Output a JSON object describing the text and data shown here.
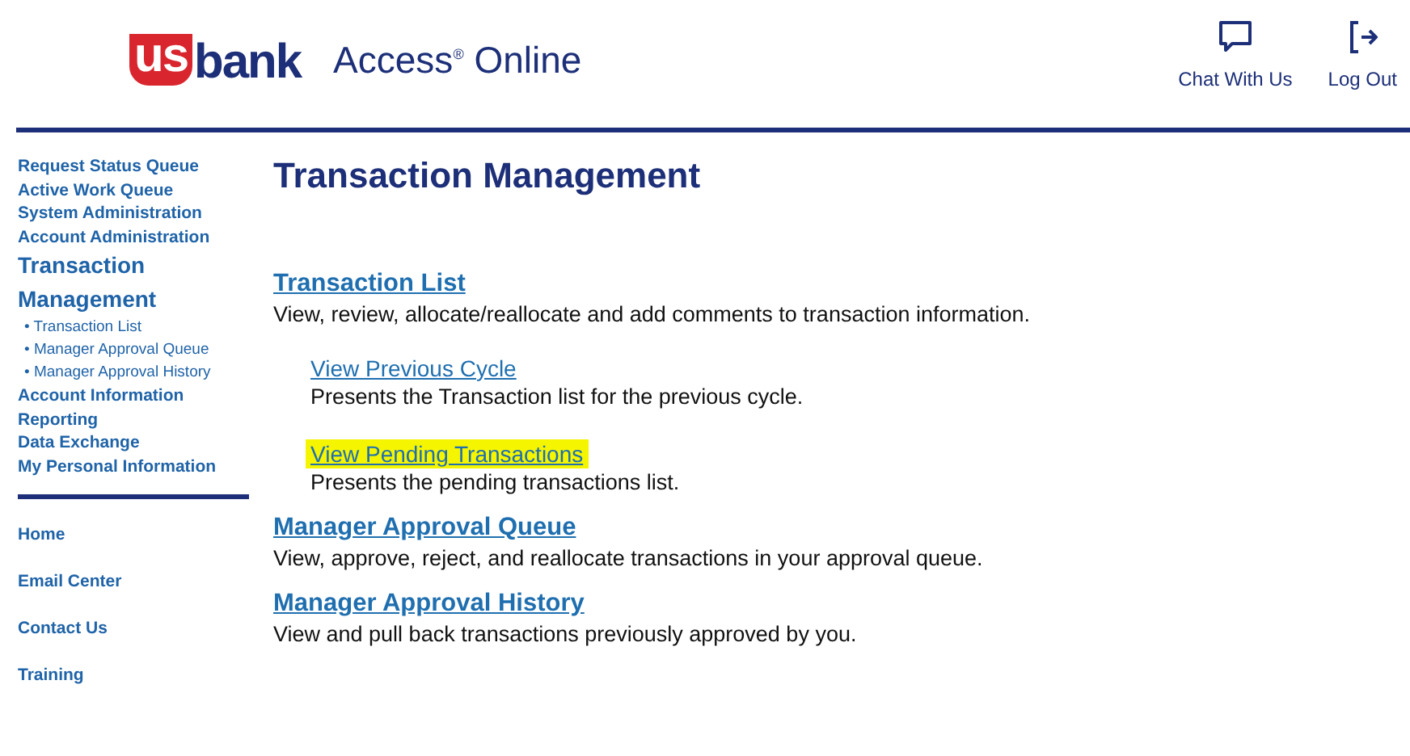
{
  "header": {
    "logo": {
      "us": "us",
      "bank": "bank"
    },
    "product": "Access$^{®}$ Online",
    "actions": [
      {
        "kind": "chat",
        "label": "Chat With Us"
      },
      {
        "kind": "logout",
        "label": "Log Out"
      }
    ]
  },
  "sidebar": {
    "items": [
      {
        "label": "Request Status Queue",
        "selected": false
      },
      {
        "label": "Active Work Queue",
        "selected": false
      },
      {
        "label": "System Administration",
        "selected": false
      },
      {
        "label": "Account Administration",
        "selected": false
      },
      {
        "label": "Transaction Management",
        "selected": true,
        "children": [
          {
            "label": "• Transaction List"
          },
          {
            "label": "• Manager Approval Queue"
          },
          {
            "label": "• Manager Approval History"
          }
        ]
      },
      {
        "label": "Account Information",
        "selected": false
      },
      {
        "label": "Reporting",
        "selected": false
      },
      {
        "label": "Data Exchange",
        "selected": false
      },
      {
        "label": "My Personal Information",
        "selected": false
      }
    ],
    "footer_links": [
      "Home",
      "Email Center",
      "Contact Us",
      "Training"
    ]
  },
  "main": {
    "title": "Transaction Management",
    "sections": [
      {
        "link": "Transaction List",
        "description": "View, review, allocate/reallocate and add comments to transaction information.",
        "children": [
          {
            "link": "View Previous Cycle",
            "description": "Presents the Transaction list for the previous cycle.",
            "highlighted": false
          },
          {
            "link": "View Pending Transactions",
            "description": "Presents the pending transactions list.",
            "highlighted": true
          }
        ]
      },
      {
        "link": "Manager Approval Queue",
        "description": "View, approve, reject, and reallocate transactions in your approval queue."
      },
      {
        "link": "Manager Approval History",
        "description": "View and pull back transactions previously approved by you."
      }
    ]
  }
}
